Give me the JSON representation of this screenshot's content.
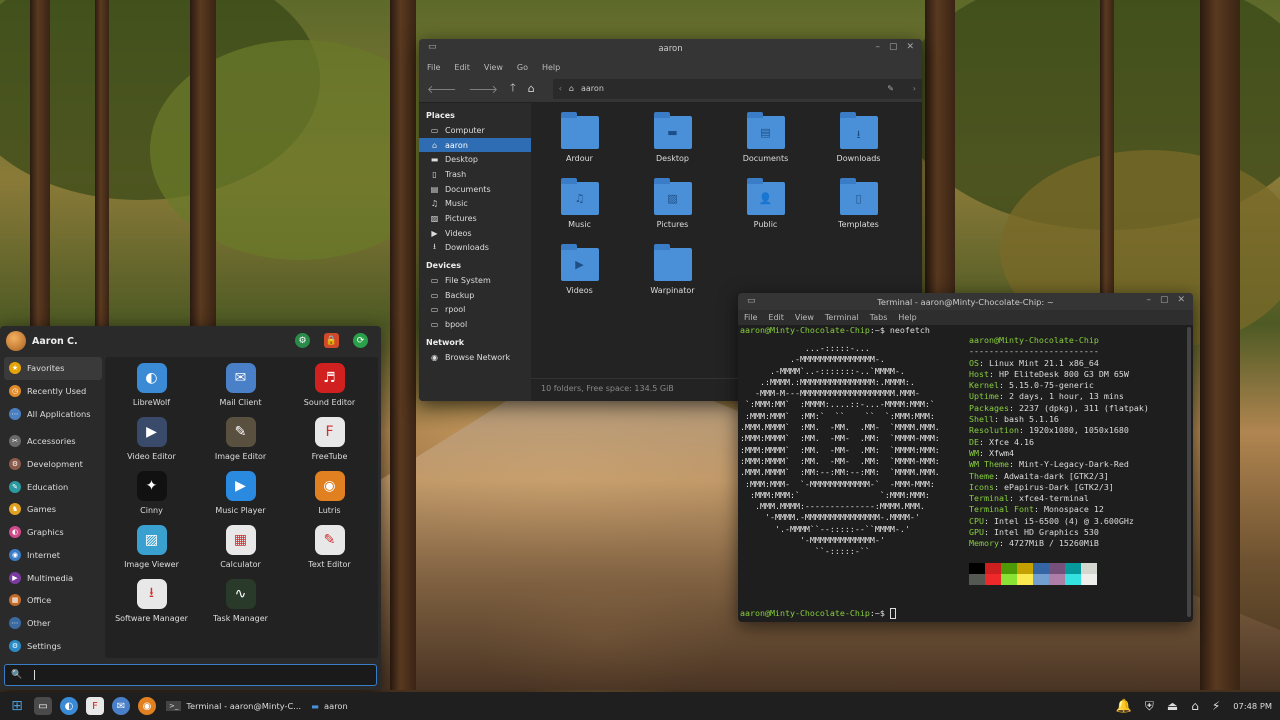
{
  "file_manager": {
    "title": "aaron",
    "menu": [
      "File",
      "Edit",
      "View",
      "Go",
      "Help"
    ],
    "path": "aaron",
    "places_header": "Places",
    "places": [
      {
        "label": "Computer",
        "icon": "monitor-icon",
        "selected": false
      },
      {
        "label": "aaron",
        "icon": "home-icon",
        "selected": true
      },
      {
        "label": "Desktop",
        "icon": "desktop-icon",
        "selected": false
      },
      {
        "label": "Trash",
        "icon": "trash-icon",
        "selected": false
      },
      {
        "label": "Documents",
        "icon": "document-icon",
        "selected": false
      },
      {
        "label": "Music",
        "icon": "music-icon",
        "selected": false
      },
      {
        "label": "Pictures",
        "icon": "picture-icon",
        "selected": false
      },
      {
        "label": "Videos",
        "icon": "video-icon",
        "selected": false
      },
      {
        "label": "Downloads",
        "icon": "download-icon",
        "selected": false
      }
    ],
    "devices_header": "Devices",
    "devices": [
      "File System",
      "Backup",
      "rpool",
      "bpool"
    ],
    "network_header": "Network",
    "network": [
      "Browse Network"
    ],
    "folders": [
      {
        "label": "Ardour",
        "glyph": ""
      },
      {
        "label": "Desktop",
        "glyph": "▬"
      },
      {
        "label": "Documents",
        "glyph": "▤"
      },
      {
        "label": "Downloads",
        "glyph": "⭳"
      },
      {
        "label": "Music",
        "glyph": "♫"
      },
      {
        "label": "Pictures",
        "glyph": "▨"
      },
      {
        "label": "Public",
        "glyph": "👤"
      },
      {
        "label": "Templates",
        "glyph": "▯"
      },
      {
        "label": "Videos",
        "glyph": "▶"
      },
      {
        "label": "Warpinator",
        "glyph": ""
      }
    ],
    "status": "10 folders, Free space: 134.5 GiB"
  },
  "terminal": {
    "title": "Terminal - aaron@Minty-Chocolate-Chip: ~",
    "menu": [
      "File",
      "Edit",
      "View",
      "Terminal",
      "Tabs",
      "Help"
    ],
    "prompt_user": "aaron@Minty-Chocolate-Chip",
    "prompt_rest": ":~$ ",
    "command": "neofetch",
    "header_user": "aaron@Minty-Chocolate-Chip",
    "divider": "--------------------------",
    "info": [
      {
        "k": "OS",
        "v": "Linux Mint 21.1 x86_64"
      },
      {
        "k": "Host",
        "v": "HP EliteDesk 800 G3 DM 65W"
      },
      {
        "k": "Kernel",
        "v": "5.15.0-75-generic"
      },
      {
        "k": "Uptime",
        "v": "2 days, 1 hour, 13 mins"
      },
      {
        "k": "Packages",
        "v": "2237 (dpkg), 311 (flatpak)"
      },
      {
        "k": "Shell",
        "v": "bash 5.1.16"
      },
      {
        "k": "Resolution",
        "v": "1920x1080, 1050x1680"
      },
      {
        "k": "DE",
        "v": "Xfce 4.16"
      },
      {
        "k": "WM",
        "v": "Xfwm4"
      },
      {
        "k": "WM Theme",
        "v": "Mint-Y-Legacy-Dark-Red"
      },
      {
        "k": "Theme",
        "v": "Adwaita-dark [GTK2/3]"
      },
      {
        "k": "Icons",
        "v": "ePapirus-Dark [GTK2/3]"
      },
      {
        "k": "Terminal",
        "v": "xfce4-terminal"
      },
      {
        "k": "Terminal Font",
        "v": "Monospace 12"
      },
      {
        "k": "CPU",
        "v": "Intel i5-6500 (4) @ 3.600GHz"
      },
      {
        "k": "GPU",
        "v": "Intel HD Graphics 530"
      },
      {
        "k": "Memory",
        "v": "4727MiB / 15260MiB"
      }
    ],
    "palette": [
      "#000000",
      "#cc2020",
      "#4e9a06",
      "#c4a000",
      "#3465a4",
      "#75507b",
      "#06989a",
      "#d3d7cf",
      "#555753",
      "#ef2929",
      "#8ae234",
      "#fce94f",
      "#729fcf",
      "#ad7fa8",
      "#34e2e2",
      "#eeeeec"
    ]
  },
  "menu": {
    "user": "Aaron C.",
    "categories": [
      {
        "label": "Favorites",
        "icon": "star-icon",
        "color": "#e5a50a",
        "glyph": "★",
        "selected": true
      },
      {
        "label": "Recently Used",
        "icon": "clock-icon",
        "color": "#e08a2a",
        "glyph": "◷",
        "selected": false
      },
      {
        "label": "All Applications",
        "icon": "apps-icon",
        "color": "#4a7fc0",
        "glyph": "⋯",
        "selected": false
      },
      {
        "label": "Accessories",
        "icon": "accessories-icon",
        "color": "#6a6a6a",
        "glyph": "✂",
        "selected": false
      },
      {
        "label": "Development",
        "icon": "development-icon",
        "color": "#8a5a4a",
        "glyph": "⚙",
        "selected": false
      },
      {
        "label": "Education",
        "icon": "education-icon",
        "color": "#2a9aa0",
        "glyph": "✎",
        "selected": false
      },
      {
        "label": "Games",
        "icon": "games-icon",
        "color": "#e0a020",
        "glyph": "♞",
        "selected": false
      },
      {
        "label": "Graphics",
        "icon": "graphics-icon",
        "color": "#d04a8a",
        "glyph": "◐",
        "selected": false
      },
      {
        "label": "Internet",
        "icon": "internet-icon",
        "color": "#3a7cc6",
        "glyph": "◉",
        "selected": false
      },
      {
        "label": "Multimedia",
        "icon": "multimedia-icon",
        "color": "#7a3aa0",
        "glyph": "▶",
        "selected": false
      },
      {
        "label": "Office",
        "icon": "office-icon",
        "color": "#c06a2a",
        "glyph": "▦",
        "selected": false
      },
      {
        "label": "Other",
        "icon": "other-icon",
        "color": "#3a6aa0",
        "glyph": "⋯",
        "selected": false
      },
      {
        "label": "Settings",
        "icon": "settings-icon",
        "color": "#2a8ac6",
        "glyph": "⚙",
        "selected": false
      }
    ],
    "apps": [
      {
        "label": "LibreWolf",
        "icon": "librewolf-icon",
        "color": "#3a8ad6",
        "glyph": "◐"
      },
      {
        "label": "Mail Client",
        "icon": "mail-client-icon",
        "color": "#4a80c8",
        "glyph": "✉"
      },
      {
        "label": "Sound Editor",
        "icon": "sound-editor-icon",
        "color": "#d02020",
        "glyph": "♬"
      },
      {
        "label": "Video Editor",
        "icon": "video-editor-icon",
        "color": "#3a4a6a",
        "glyph": "▶"
      },
      {
        "label": "Image Editor",
        "icon": "image-editor-icon",
        "color": "#5a5040",
        "glyph": "✎"
      },
      {
        "label": "FreeTube",
        "icon": "freetube-icon",
        "color": "#e8e8e8",
        "glyph": "F"
      },
      {
        "label": "Cinny",
        "icon": "cinny-icon",
        "color": "#111111",
        "glyph": "✦"
      },
      {
        "label": "Music Player",
        "icon": "music-player-icon",
        "color": "#2a8ae0",
        "glyph": "▶"
      },
      {
        "label": "Lutris",
        "icon": "lutris-icon",
        "color": "#e08020",
        "glyph": "◉"
      },
      {
        "label": "Image Viewer",
        "icon": "image-viewer-icon",
        "color": "#3aa0d0",
        "glyph": "▨"
      },
      {
        "label": "Calculator",
        "icon": "calculator-icon",
        "color": "#e8e8e8",
        "glyph": "▦"
      },
      {
        "label": "Text Editor",
        "icon": "text-editor-icon",
        "color": "#e8e8e8",
        "glyph": "✎"
      },
      {
        "label": "Software Manager",
        "icon": "software-manager-icon",
        "color": "#e8e8e8",
        "glyph": "⭳"
      },
      {
        "label": "Task Manager",
        "icon": "task-manager-icon",
        "color": "#2a3a2a",
        "glyph": "∿"
      }
    ],
    "search_value": ""
  },
  "panel": {
    "tasks": [
      {
        "label": "Terminal - aaron@Minty-C...",
        "icon": "terminal-icon"
      },
      {
        "label": "aaron",
        "icon": "folder-icon"
      }
    ],
    "clock": "07:48 PM"
  }
}
